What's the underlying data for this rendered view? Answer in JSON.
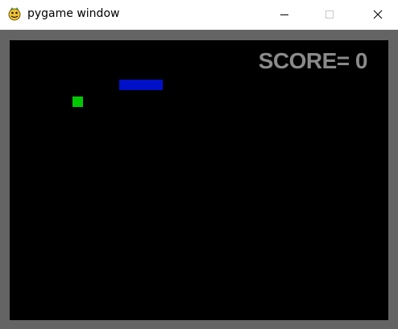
{
  "window": {
    "title": "pygame window",
    "app_icon": "pygame-snake-icon",
    "controls": {
      "minimize_icon": "minimize-icon",
      "maximize_icon": "maximize-icon",
      "close_icon": "close-icon"
    }
  },
  "game": {
    "score_label": "SCORE=",
    "score_value": "0",
    "colors": {
      "background": "#000000",
      "border": "#646464",
      "score_text": "#8a8a8a",
      "paddle": "#0010c8",
      "ball": "#00c800"
    }
  }
}
